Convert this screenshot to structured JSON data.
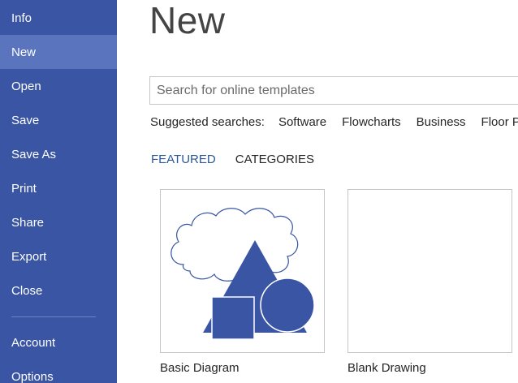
{
  "sidebar": {
    "items": [
      {
        "label": "Info"
      },
      {
        "label": "New"
      },
      {
        "label": "Open"
      },
      {
        "label": "Save"
      },
      {
        "label": "Save As"
      },
      {
        "label": "Print"
      },
      {
        "label": "Share"
      },
      {
        "label": "Export"
      },
      {
        "label": "Close"
      },
      {
        "label": "Account"
      },
      {
        "label": "Options"
      }
    ],
    "active_item": "New"
  },
  "main": {
    "title": "New",
    "search": {
      "placeholder": "Search for online templates",
      "value": ""
    },
    "suggested": {
      "label": "Suggested searches:",
      "links": [
        "Software",
        "Flowcharts",
        "Business",
        "Floor Pl"
      ]
    },
    "tabs": [
      {
        "label": "FEATURED",
        "active": true
      },
      {
        "label": "CATEGORIES",
        "active": false
      }
    ],
    "templates": [
      {
        "label": "Basic Diagram",
        "icon": "basic-diagram-thumbnail"
      },
      {
        "label": "Blank Drawing",
        "icon": "blank-drawing-thumbnail"
      }
    ]
  },
  "colors": {
    "sidebar_bg": "#3955a3",
    "sidebar_active": "#5a74bd",
    "accent": "#2b579a",
    "shape_fill": "#3955a3"
  }
}
